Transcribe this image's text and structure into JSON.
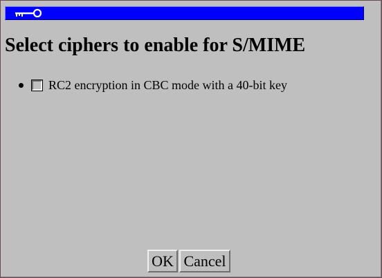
{
  "banner": {
    "icon": "key-icon",
    "color": "#0000ff"
  },
  "dialog": {
    "title": "Select ciphers to enable for S/MIME",
    "background": "#bfbfbf"
  },
  "ciphers": [
    {
      "label": "RC2 encryption in CBC mode with a 40-bit key",
      "checked": false
    }
  ],
  "buttons": {
    "ok_label": "OK",
    "cancel_label": "Cancel"
  }
}
